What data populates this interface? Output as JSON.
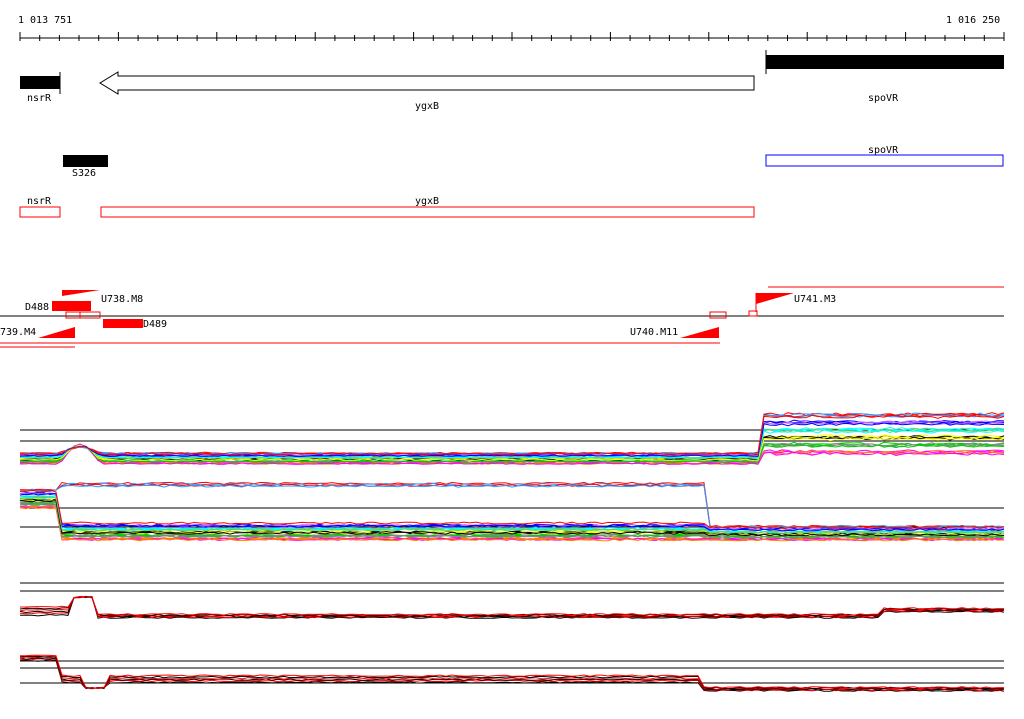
{
  "ruler": {
    "start_label": "1 013 751",
    "end_label": "1 016 250"
  },
  "features": {
    "nsrR_label": "nsrR",
    "ygxB_label": "ygxB",
    "spoVR_label": "spoVR",
    "s326_label": "S326",
    "spoVR2_label": "spoVR",
    "nsrR2_label": "nsrR",
    "ygxB2_label": "ygxB"
  },
  "segments": {
    "d488": "D488",
    "u738": "U738.M8",
    "d489": "D489",
    "m739": "739.M4",
    "u740": "U740.M11",
    "u741": "U741.M3"
  },
  "colors": {
    "feature_fill": "#000000",
    "annotation_red": "#ff0000",
    "annotation_blue": "#0000ff",
    "series": [
      "#ff00ff",
      "#00cc00",
      "#ffff00",
      "#00ffff",
      "#0000ff",
      "#ff0000",
      "#ff8800",
      "#888888",
      "#000000",
      "#66cc66",
      "#cc66ff",
      "#3399ff"
    ]
  }
}
